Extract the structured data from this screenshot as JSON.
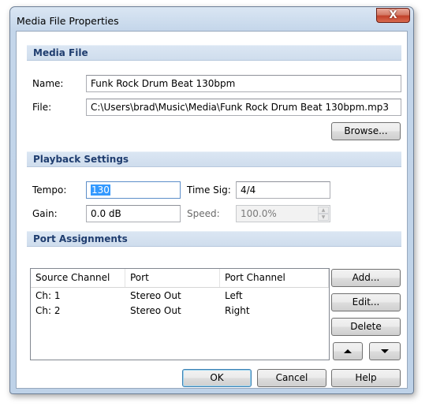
{
  "window": {
    "title": "Media File Properties",
    "close_glyph": "X"
  },
  "media_file": {
    "header": "Media File",
    "name_label": "Name:",
    "name_value": "Funk Rock Drum Beat 130bpm",
    "file_label": "File:",
    "file_value": "C:\\Users\\brad\\Music\\Media\\Funk Rock Drum Beat 130bpm.mp3",
    "browse_label": "Browse..."
  },
  "playback": {
    "header": "Playback Settings",
    "tempo_label": "Tempo:",
    "tempo_value": "130",
    "timesig_label": "Time Sig:",
    "timesig_value": "4/4",
    "gain_label": "Gain:",
    "gain_value": "0.0 dB",
    "speed_label": "Speed:",
    "speed_value": "100.0%"
  },
  "ports": {
    "header": "Port Assignments",
    "columns": [
      "Source Channel",
      "Port",
      "Port Channel"
    ],
    "rows": [
      [
        "Ch: 1",
        "Stereo Out",
        "Left"
      ],
      [
        "Ch: 2",
        "Stereo Out",
        "Right"
      ]
    ],
    "add_label": "Add...",
    "edit_label": "Edit...",
    "delete_label": "Delete"
  },
  "footer": {
    "ok_label": "OK",
    "cancel_label": "Cancel",
    "help_label": "Help"
  },
  "icons": {
    "close": "close-icon",
    "move_up": "arrow-up-icon",
    "move_down": "arrow-down-icon"
  }
}
